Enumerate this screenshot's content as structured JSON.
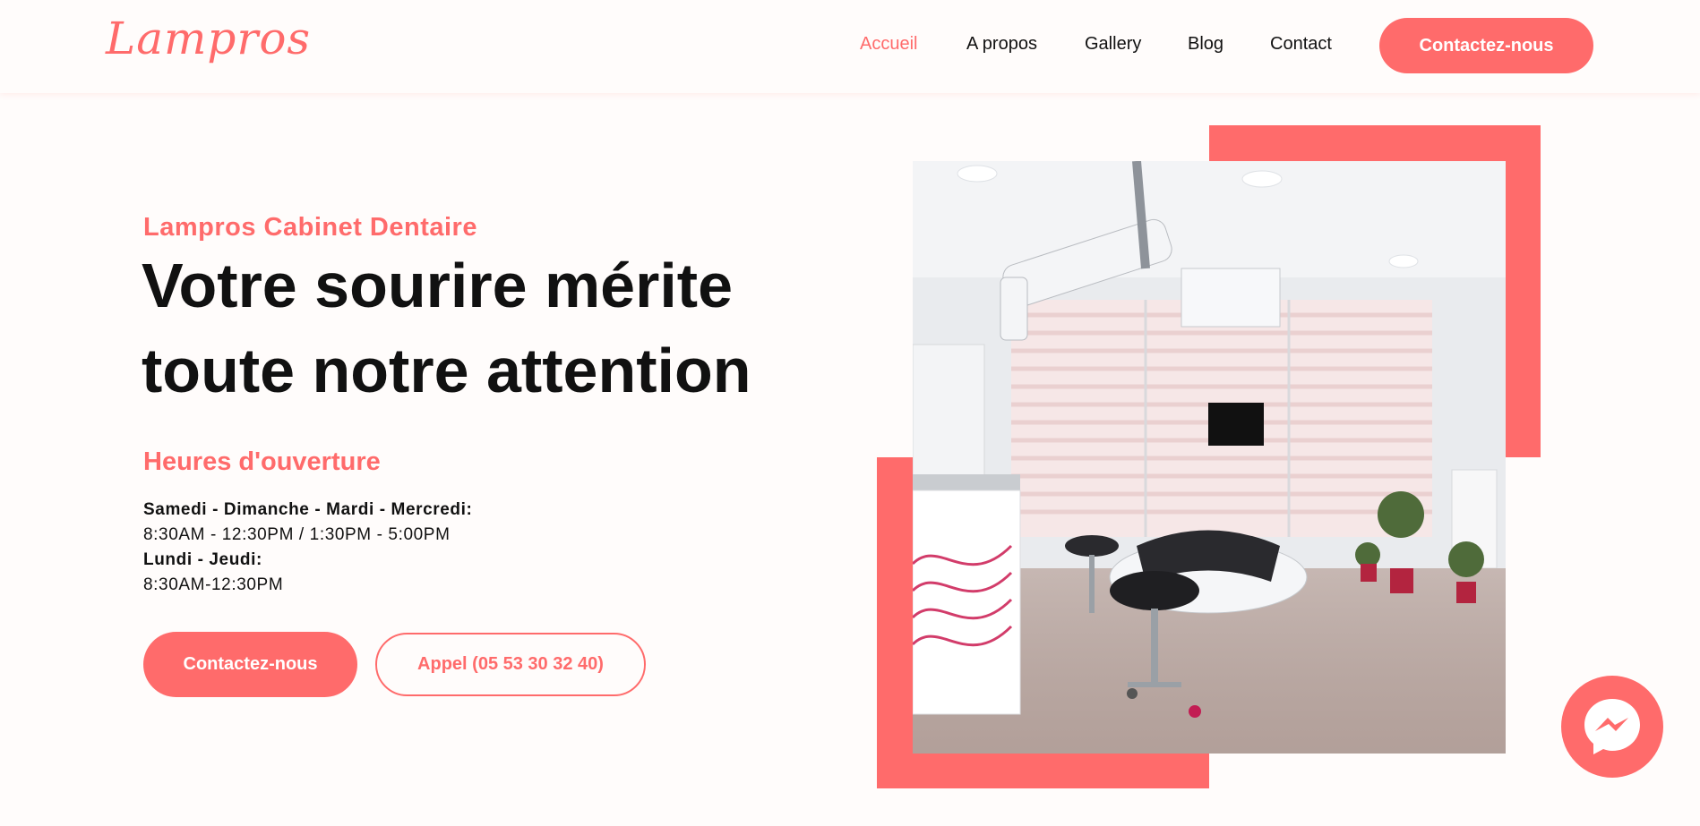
{
  "brand": {
    "logo": "Lampros",
    "accent_color": "#ff6b6b"
  },
  "nav": {
    "items": [
      {
        "label": "Accueil",
        "active": true
      },
      {
        "label": "A propos",
        "active": false
      },
      {
        "label": "Gallery",
        "active": false
      },
      {
        "label": "Blog",
        "active": false
      },
      {
        "label": "Contact",
        "active": false
      }
    ],
    "cta_label": "Contactez-nous"
  },
  "hero": {
    "subtitle": "Lampros Cabinet Dentaire",
    "headline_line1": "Votre sourire mérite",
    "headline_line2": "toute notre attention",
    "hours_title": "Heures d'ouverture",
    "hours": [
      {
        "days": "Samedi - Dimanche - Mardi - Mercredi:",
        "time": "8:30AM - 12:30PM / 1:30PM - 5:00PM"
      },
      {
        "days": "Lundi - Jeudi:",
        "time": "8:30AM-12:30PM"
      }
    ],
    "contact_button": "Contactez-nous",
    "call_button": "Appel (05 53 30 32 40)"
  },
  "image": {
    "subject": "dental-clinic-room-photo"
  },
  "floating": {
    "icon": "messenger-icon"
  }
}
